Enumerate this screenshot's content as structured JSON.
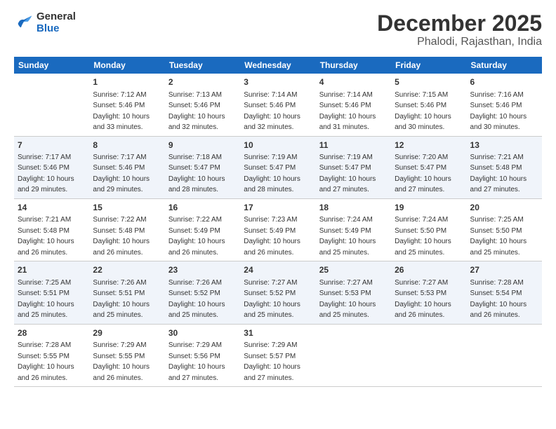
{
  "logo": {
    "text_general": "General",
    "text_blue": "Blue"
  },
  "header": {
    "month_year": "December 2025",
    "location": "Phalodi, Rajasthan, India"
  },
  "days_of_week": [
    "Sunday",
    "Monday",
    "Tuesday",
    "Wednesday",
    "Thursday",
    "Friday",
    "Saturday"
  ],
  "weeks": [
    [
      {
        "day": "",
        "sunrise": "",
        "sunset": "",
        "daylight": ""
      },
      {
        "day": "1",
        "sunrise": "Sunrise: 7:12 AM",
        "sunset": "Sunset: 5:46 PM",
        "daylight": "Daylight: 10 hours and 33 minutes."
      },
      {
        "day": "2",
        "sunrise": "Sunrise: 7:13 AM",
        "sunset": "Sunset: 5:46 PM",
        "daylight": "Daylight: 10 hours and 32 minutes."
      },
      {
        "day": "3",
        "sunrise": "Sunrise: 7:14 AM",
        "sunset": "Sunset: 5:46 PM",
        "daylight": "Daylight: 10 hours and 32 minutes."
      },
      {
        "day": "4",
        "sunrise": "Sunrise: 7:14 AM",
        "sunset": "Sunset: 5:46 PM",
        "daylight": "Daylight: 10 hours and 31 minutes."
      },
      {
        "day": "5",
        "sunrise": "Sunrise: 7:15 AM",
        "sunset": "Sunset: 5:46 PM",
        "daylight": "Daylight: 10 hours and 30 minutes."
      },
      {
        "day": "6",
        "sunrise": "Sunrise: 7:16 AM",
        "sunset": "Sunset: 5:46 PM",
        "daylight": "Daylight: 10 hours and 30 minutes."
      }
    ],
    [
      {
        "day": "7",
        "sunrise": "Sunrise: 7:17 AM",
        "sunset": "Sunset: 5:46 PM",
        "daylight": "Daylight: 10 hours and 29 minutes."
      },
      {
        "day": "8",
        "sunrise": "Sunrise: 7:17 AM",
        "sunset": "Sunset: 5:46 PM",
        "daylight": "Daylight: 10 hours and 29 minutes."
      },
      {
        "day": "9",
        "sunrise": "Sunrise: 7:18 AM",
        "sunset": "Sunset: 5:47 PM",
        "daylight": "Daylight: 10 hours and 28 minutes."
      },
      {
        "day": "10",
        "sunrise": "Sunrise: 7:19 AM",
        "sunset": "Sunset: 5:47 PM",
        "daylight": "Daylight: 10 hours and 28 minutes."
      },
      {
        "day": "11",
        "sunrise": "Sunrise: 7:19 AM",
        "sunset": "Sunset: 5:47 PM",
        "daylight": "Daylight: 10 hours and 27 minutes."
      },
      {
        "day": "12",
        "sunrise": "Sunrise: 7:20 AM",
        "sunset": "Sunset: 5:47 PM",
        "daylight": "Daylight: 10 hours and 27 minutes."
      },
      {
        "day": "13",
        "sunrise": "Sunrise: 7:21 AM",
        "sunset": "Sunset: 5:48 PM",
        "daylight": "Daylight: 10 hours and 27 minutes."
      }
    ],
    [
      {
        "day": "14",
        "sunrise": "Sunrise: 7:21 AM",
        "sunset": "Sunset: 5:48 PM",
        "daylight": "Daylight: 10 hours and 26 minutes."
      },
      {
        "day": "15",
        "sunrise": "Sunrise: 7:22 AM",
        "sunset": "Sunset: 5:48 PM",
        "daylight": "Daylight: 10 hours and 26 minutes."
      },
      {
        "day": "16",
        "sunrise": "Sunrise: 7:22 AM",
        "sunset": "Sunset: 5:49 PM",
        "daylight": "Daylight: 10 hours and 26 minutes."
      },
      {
        "day": "17",
        "sunrise": "Sunrise: 7:23 AM",
        "sunset": "Sunset: 5:49 PM",
        "daylight": "Daylight: 10 hours and 26 minutes."
      },
      {
        "day": "18",
        "sunrise": "Sunrise: 7:24 AM",
        "sunset": "Sunset: 5:49 PM",
        "daylight": "Daylight: 10 hours and 25 minutes."
      },
      {
        "day": "19",
        "sunrise": "Sunrise: 7:24 AM",
        "sunset": "Sunset: 5:50 PM",
        "daylight": "Daylight: 10 hours and 25 minutes."
      },
      {
        "day": "20",
        "sunrise": "Sunrise: 7:25 AM",
        "sunset": "Sunset: 5:50 PM",
        "daylight": "Daylight: 10 hours and 25 minutes."
      }
    ],
    [
      {
        "day": "21",
        "sunrise": "Sunrise: 7:25 AM",
        "sunset": "Sunset: 5:51 PM",
        "daylight": "Daylight: 10 hours and 25 minutes."
      },
      {
        "day": "22",
        "sunrise": "Sunrise: 7:26 AM",
        "sunset": "Sunset: 5:51 PM",
        "daylight": "Daylight: 10 hours and 25 minutes."
      },
      {
        "day": "23",
        "sunrise": "Sunrise: 7:26 AM",
        "sunset": "Sunset: 5:52 PM",
        "daylight": "Daylight: 10 hours and 25 minutes."
      },
      {
        "day": "24",
        "sunrise": "Sunrise: 7:27 AM",
        "sunset": "Sunset: 5:52 PM",
        "daylight": "Daylight: 10 hours and 25 minutes."
      },
      {
        "day": "25",
        "sunrise": "Sunrise: 7:27 AM",
        "sunset": "Sunset: 5:53 PM",
        "daylight": "Daylight: 10 hours and 25 minutes."
      },
      {
        "day": "26",
        "sunrise": "Sunrise: 7:27 AM",
        "sunset": "Sunset: 5:53 PM",
        "daylight": "Daylight: 10 hours and 26 minutes."
      },
      {
        "day": "27",
        "sunrise": "Sunrise: 7:28 AM",
        "sunset": "Sunset: 5:54 PM",
        "daylight": "Daylight: 10 hours and 26 minutes."
      }
    ],
    [
      {
        "day": "28",
        "sunrise": "Sunrise: 7:28 AM",
        "sunset": "Sunset: 5:55 PM",
        "daylight": "Daylight: 10 hours and 26 minutes."
      },
      {
        "day": "29",
        "sunrise": "Sunrise: 7:29 AM",
        "sunset": "Sunset: 5:55 PM",
        "daylight": "Daylight: 10 hours and 26 minutes."
      },
      {
        "day": "30",
        "sunrise": "Sunrise: 7:29 AM",
        "sunset": "Sunset: 5:56 PM",
        "daylight": "Daylight: 10 hours and 27 minutes."
      },
      {
        "day": "31",
        "sunrise": "Sunrise: 7:29 AM",
        "sunset": "Sunset: 5:57 PM",
        "daylight": "Daylight: 10 hours and 27 minutes."
      },
      {
        "day": "",
        "sunrise": "",
        "sunset": "",
        "daylight": ""
      },
      {
        "day": "",
        "sunrise": "",
        "sunset": "",
        "daylight": ""
      },
      {
        "day": "",
        "sunrise": "",
        "sunset": "",
        "daylight": ""
      }
    ]
  ]
}
